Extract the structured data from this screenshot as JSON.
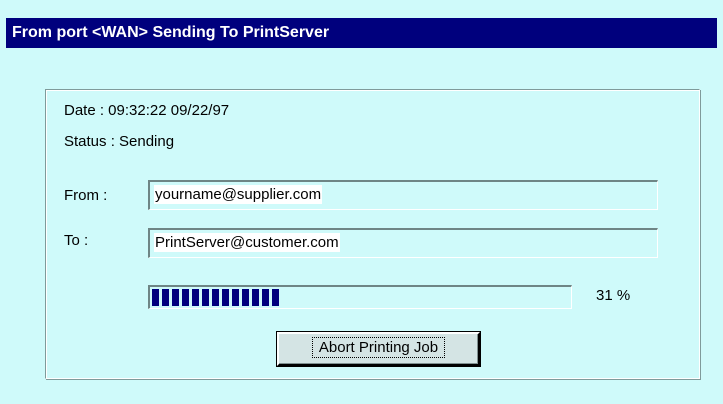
{
  "window": {
    "title": "From port <WAN> Sending To PrintServer"
  },
  "info": {
    "date": "Date : 09:32:22 09/22/97",
    "status": "Status : Sending"
  },
  "form": {
    "from_label": "From :",
    "from_value": "yourname@supplier.com",
    "to_label": "To :",
    "to_value": "PrintServer@customer.com"
  },
  "progress": {
    "value": 0.31,
    "text": "31 %",
    "fill_color": "#00007d"
  },
  "actions": {
    "abort_label": "Abort Printing Job"
  },
  "colors": {
    "background": "#cffafa",
    "titlebar": "#00007d"
  }
}
